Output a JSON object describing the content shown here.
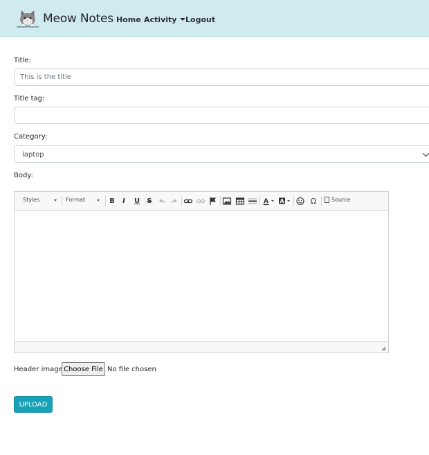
{
  "navbar": {
    "brand": "Meow Notes",
    "links": {
      "home": "Home",
      "activity": "Activity",
      "logout": "Logout"
    }
  },
  "form": {
    "title_label": "Title:",
    "title_placeholder": "This is the title",
    "title_tag_label": "Title tag:",
    "title_tag_value": "",
    "category_label": "Category:",
    "category_value": "laptop",
    "body_label": "Body:",
    "header_image_label": "Header image:",
    "file_button": "Choose File",
    "file_status": "No file chosen",
    "upload_button": "UPLOAD"
  },
  "editor": {
    "styles_combo": "Styles",
    "format_combo": "Format",
    "bold": "B",
    "italic": "I",
    "underline": "U",
    "strike": "S",
    "special_char": "Ω",
    "source": "Source"
  },
  "colors": {
    "navbar_bg": "#d1eaf0",
    "upload_button": "#17a2b8"
  }
}
